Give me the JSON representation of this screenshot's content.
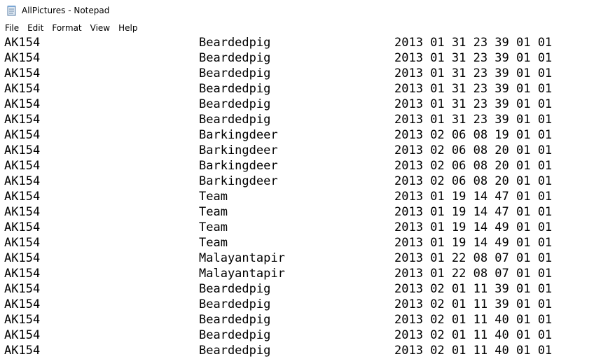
{
  "window": {
    "title": "AllPictures - Notepad"
  },
  "menu": [
    "File",
    "Edit",
    "Format",
    "View",
    "Help"
  ],
  "rows": [
    [
      "AK154",
      "Beardedpig",
      "2013 01 31 23 39 01 01"
    ],
    [
      "AK154",
      "Beardedpig",
      "2013 01 31 23 39 01 01"
    ],
    [
      "AK154",
      "Beardedpig",
      "2013 01 31 23 39 01 01"
    ],
    [
      "AK154",
      "Beardedpig",
      "2013 01 31 23 39 01 01"
    ],
    [
      "AK154",
      "Beardedpig",
      "2013 01 31 23 39 01 01"
    ],
    [
      "AK154",
      "Beardedpig",
      "2013 01 31 23 39 01 01"
    ],
    [
      "AK154",
      "Barkingdeer",
      "2013 02 06 08 19 01 01"
    ],
    [
      "AK154",
      "Barkingdeer",
      "2013 02 06 08 20 01 01"
    ],
    [
      "AK154",
      "Barkingdeer",
      "2013 02 06 08 20 01 01"
    ],
    [
      "AK154",
      "Barkingdeer",
      "2013 02 06 08 20 01 01"
    ],
    [
      "AK154",
      "Team",
      "2013 01 19 14 47 01 01"
    ],
    [
      "AK154",
      "Team",
      "2013 01 19 14 47 01 01"
    ],
    [
      "AK154",
      "Team",
      "2013 01 19 14 49 01 01"
    ],
    [
      "AK154",
      "Team",
      "2013 01 19 14 49 01 01"
    ],
    [
      "AK154",
      "Malayantapir",
      "2013 01 22 08 07 01 01"
    ],
    [
      "AK154",
      "Malayantapir",
      "2013 01 22 08 07 01 01"
    ],
    [
      "AK154",
      "Beardedpig",
      "2013 02 01 11 39 01 01"
    ],
    [
      "AK154",
      "Beardedpig",
      "2013 02 01 11 39 01 01"
    ],
    [
      "AK154",
      "Beardedpig",
      "2013 02 01 11 40 01 01"
    ],
    [
      "AK154",
      "Beardedpig",
      "2013 02 01 11 40 01 01"
    ],
    [
      "AK154",
      "Beardedpig",
      "2013 02 01 11 40 01 01"
    ]
  ]
}
